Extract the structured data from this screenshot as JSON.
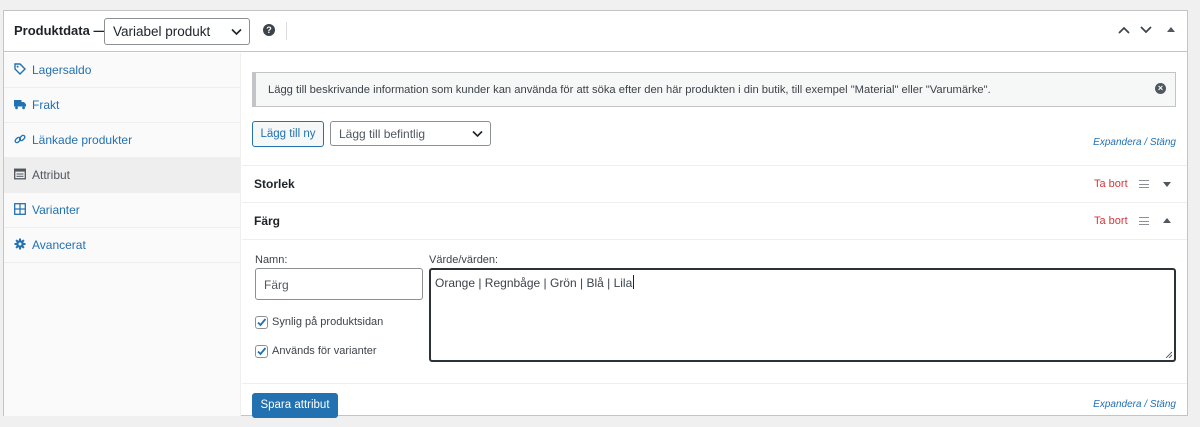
{
  "header": {
    "title": "Produktdata —",
    "product_type": "Variabel produkt",
    "help_icon": "help-icon"
  },
  "sidebar": {
    "items": [
      {
        "label": "Lagersaldo",
        "icon": "tag-icon",
        "active": false
      },
      {
        "label": "Frakt",
        "icon": "truck-icon",
        "active": false
      },
      {
        "label": "Länkade produkter",
        "icon": "link-icon",
        "active": false
      },
      {
        "label": "Attribut",
        "icon": "table-icon",
        "active": true
      },
      {
        "label": "Varianter",
        "icon": "grid-icon",
        "active": false
      },
      {
        "label": "Avancerat",
        "icon": "gear-icon",
        "active": false
      }
    ]
  },
  "notice": {
    "text": "Lägg till beskrivande information som kunder kan använda för att söka efter den här produkten i din butik, till exempel \"Material\" eller \"Varumärke\"."
  },
  "toolbar": {
    "add_new": "Lägg till ny",
    "add_existing_placeholder": "Lägg till befintlig",
    "expand_collapse": "Expandera / Stäng"
  },
  "attributes": [
    {
      "name": "Storlek",
      "remove": "Ta bort",
      "expanded": false
    },
    {
      "name": "Färg",
      "remove": "Ta bort",
      "expanded": true
    }
  ],
  "attribute_form": {
    "name_label": "Namn:",
    "name_value": "Färg",
    "values_label": "Värde/värden:",
    "values_value": "Orange | Regnbåge | Grön | Blå | Lila",
    "visible_label": "Synlig på produktsidan",
    "visible_checked": true,
    "variations_label": "Används för varianter",
    "variations_checked": true
  },
  "footer": {
    "save": "Spara attribut",
    "expand_collapse": "Expandera / Stäng"
  },
  "colors": {
    "accent": "#2271b1",
    "danger": "#d63638",
    "border": "#c3c4c7"
  }
}
